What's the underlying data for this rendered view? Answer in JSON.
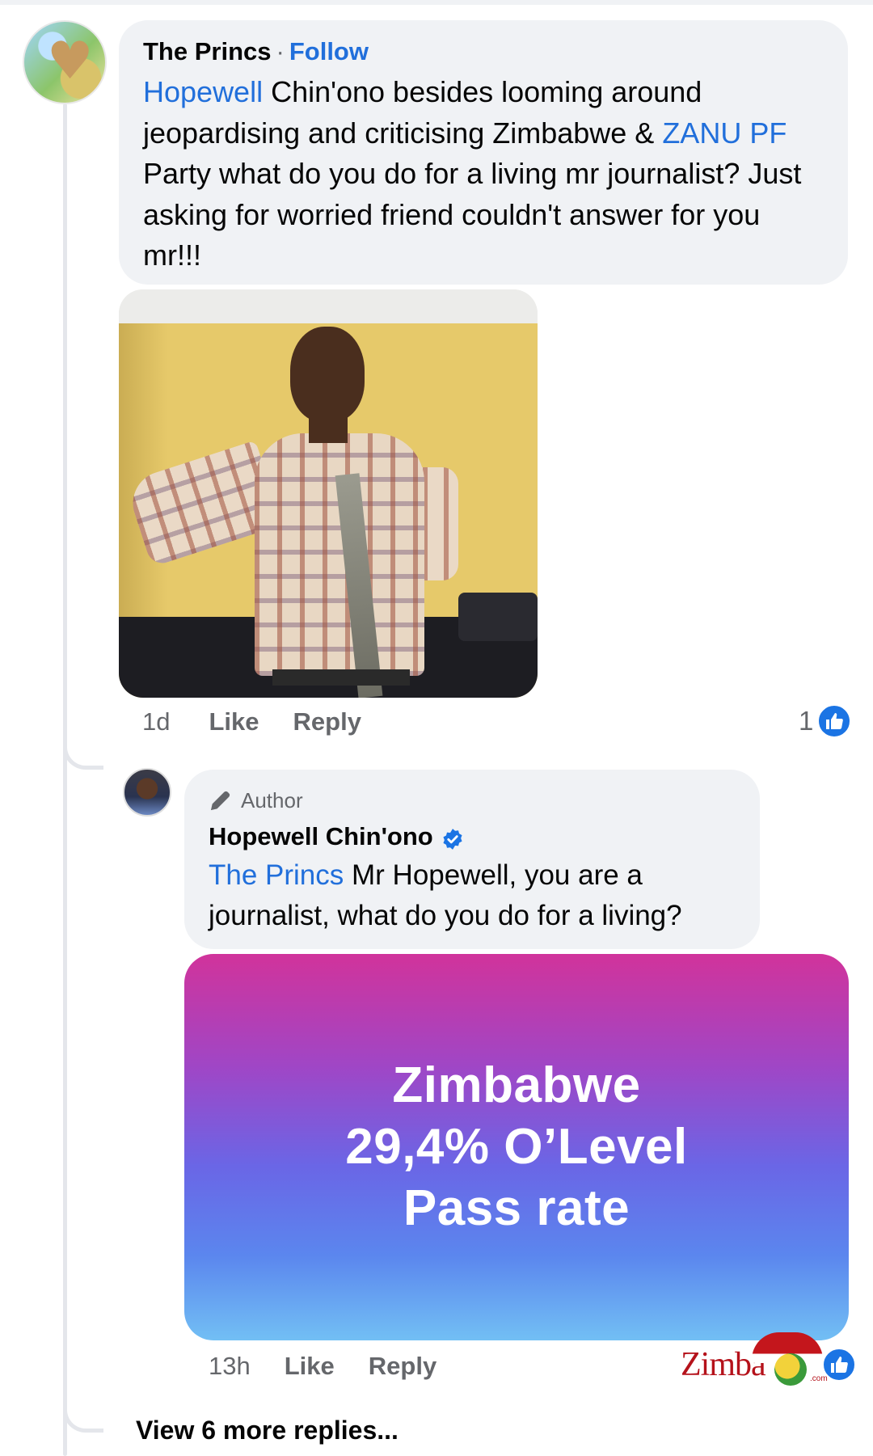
{
  "comment": {
    "author": "The Princs",
    "separator": "·",
    "follow_label": "Follow",
    "mention_1": "Hopewell",
    "text_1": " Chin'ono besides looming around jeopardising and criticising Zimbabwe & ",
    "mention_2": "ZANU PF",
    "text_2": " Party what do you do for a living mr journalist? Just asking for worried friend couldn't answer for you mr!!!",
    "time": "1d",
    "like_label": "Like",
    "reply_label": "Reply",
    "reaction_count": "1"
  },
  "reply": {
    "badge": "Author",
    "author": "Hopewell Chin'ono",
    "mention": "The Princs",
    "text": " Mr Hopewell, you are a journalist, what do you do for a living?",
    "image_text": {
      "line1": "Zimbabwe",
      "line2": "29,4% O’Level",
      "line3": "Pass rate"
    },
    "time": "13h",
    "like_label": "Like",
    "reply_label": "Reply"
  },
  "view_more": "View 6 more replies...",
  "watermark": {
    "text": "Zimba",
    "suffix": ".com"
  },
  "colors": {
    "link": "#216fdb",
    "bubble": "#f0f2f5",
    "muted": "#65676b",
    "like": "#1b74e4"
  },
  "icons": [
    "pen-icon",
    "verified-icon",
    "like-icon"
  ]
}
